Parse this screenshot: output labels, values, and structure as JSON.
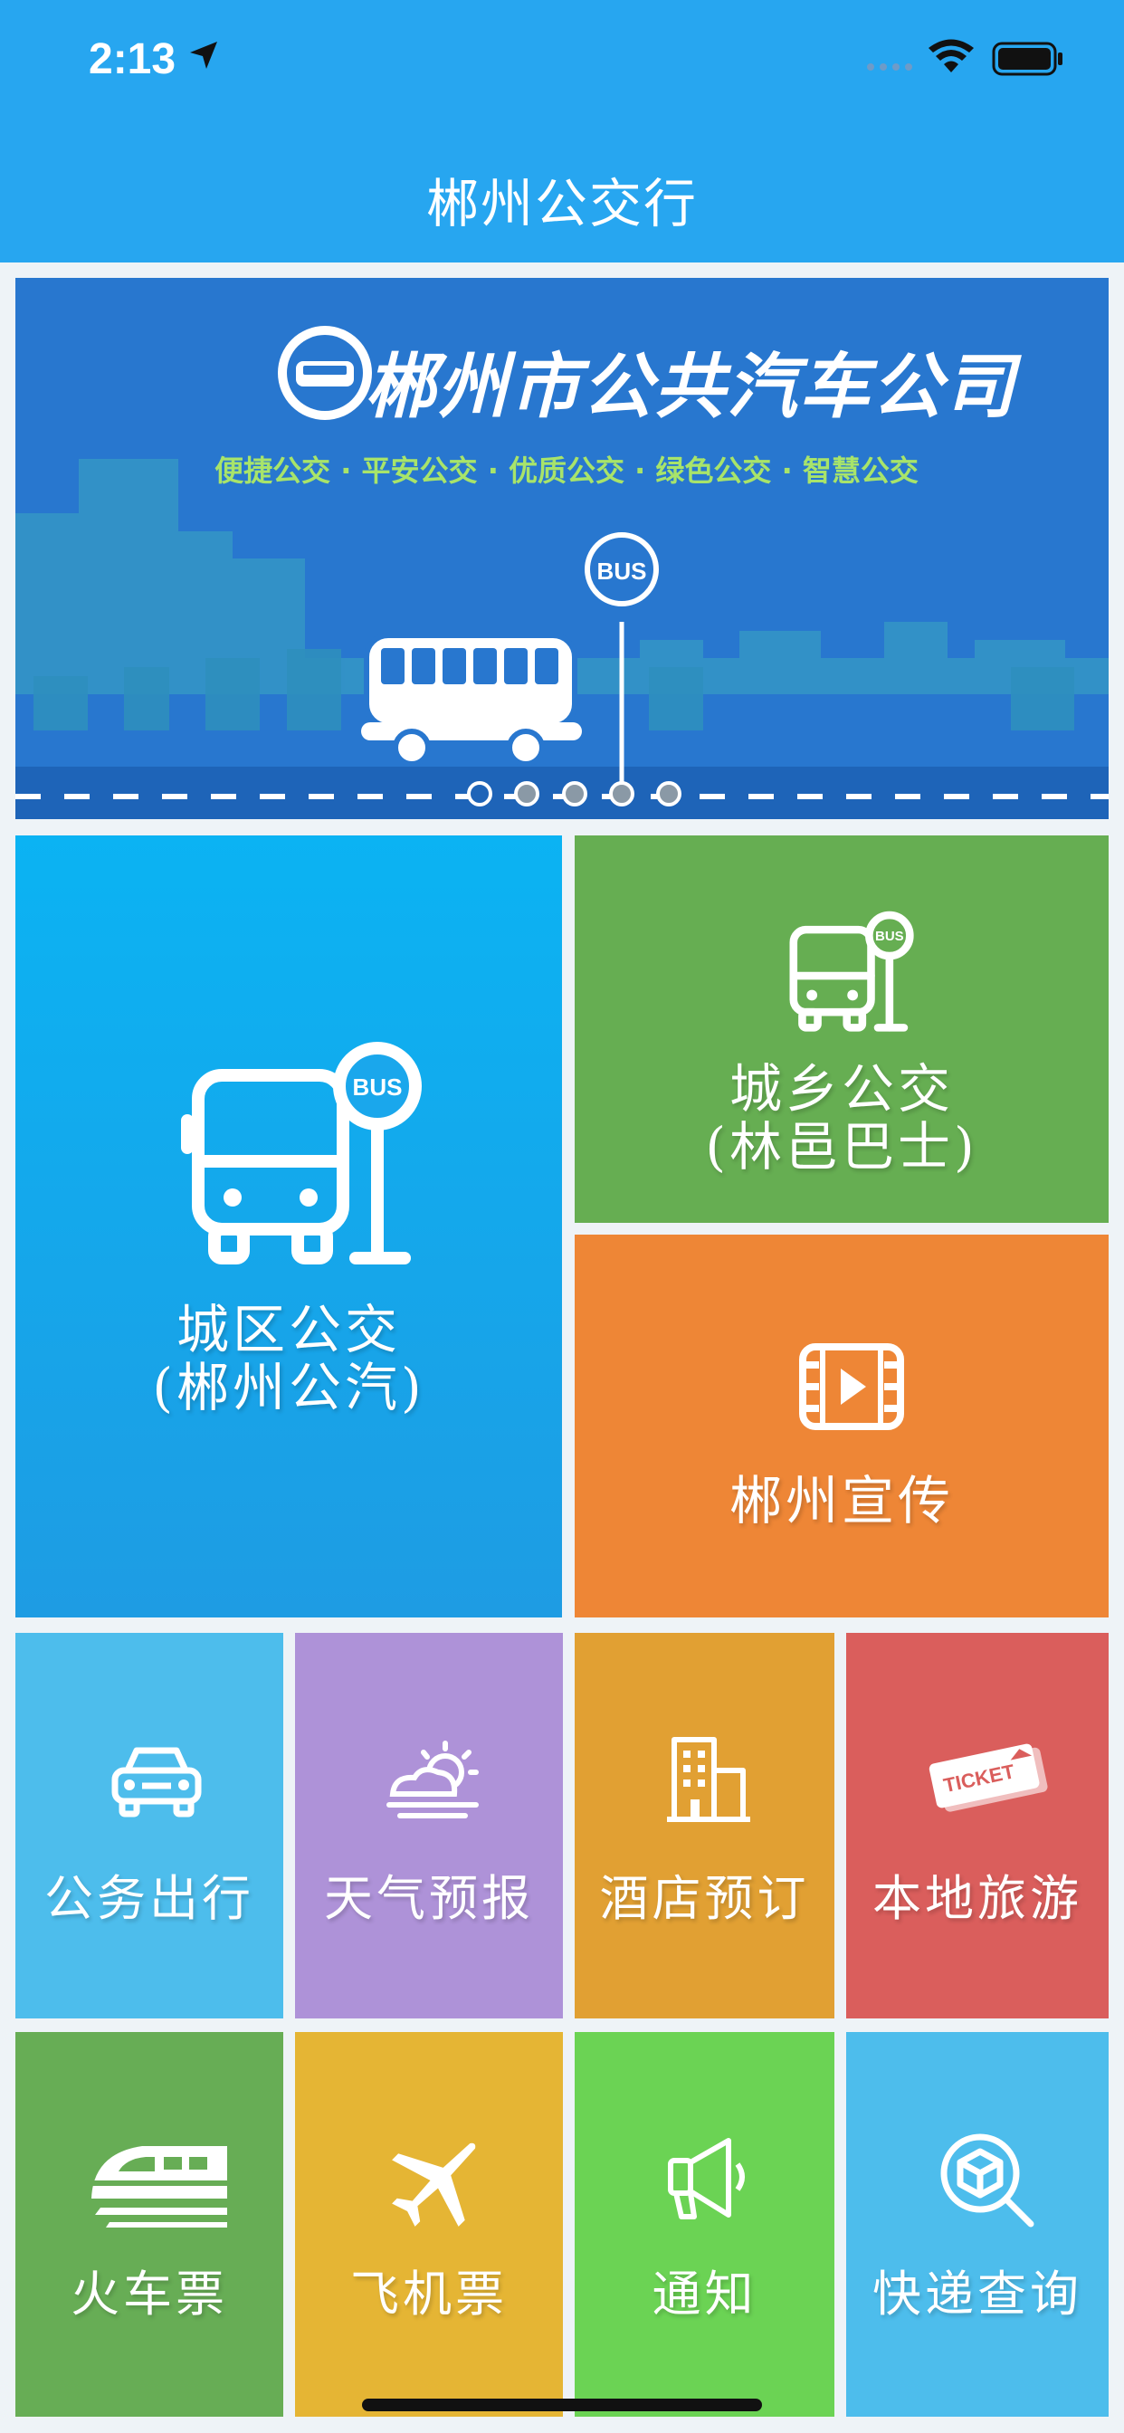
{
  "status_bar": {
    "time": "2:13"
  },
  "app": {
    "title": "郴州公交行"
  },
  "banner": {
    "company_name": "郴州市公共汽车公司",
    "slogan": "便捷公交 · 平安公交 · 优质公交 · 绿色公交 · 智慧公交",
    "bus_sign": "BUS"
  },
  "tiles": {
    "city_bus": {
      "line1": "城区公交",
      "line2": "(郴州公汽)",
      "icon": "bus-stop-icon",
      "badge": "BUS",
      "color": "#1AA7EC"
    },
    "rural_bus": {
      "line1": "城乡公交",
      "line2": "(林邑巴士)",
      "icon": "bus-stop-icon",
      "badge": "BUS",
      "color": "#66AE52"
    },
    "promo": {
      "label": "郴州宣传",
      "icon": "video-icon",
      "color": "#EE8636"
    },
    "official_travel": {
      "label": "公务出行",
      "icon": "car-icon",
      "color": "#4DBDEC"
    },
    "weather": {
      "label": "天气预报",
      "icon": "weather-icon",
      "color": "#AE92D8"
    },
    "hotel": {
      "label": "酒店预订",
      "icon": "building-icon",
      "color": "#E1A033"
    },
    "tourism": {
      "label": "本地旅游",
      "icon": "ticket-icon",
      "ticket_text": "TICKET",
      "color": "#DA5E5C"
    },
    "train": {
      "label": "火车票",
      "icon": "train-icon",
      "color": "#67AD55"
    },
    "flight": {
      "label": "飞机票",
      "icon": "plane-icon",
      "color": "#E5B534"
    },
    "notice": {
      "label": "通知",
      "icon": "megaphone-icon",
      "color": "#6BD354"
    },
    "express": {
      "label": "快递查询",
      "icon": "package-search-icon",
      "color": "#4DBDEC"
    }
  }
}
